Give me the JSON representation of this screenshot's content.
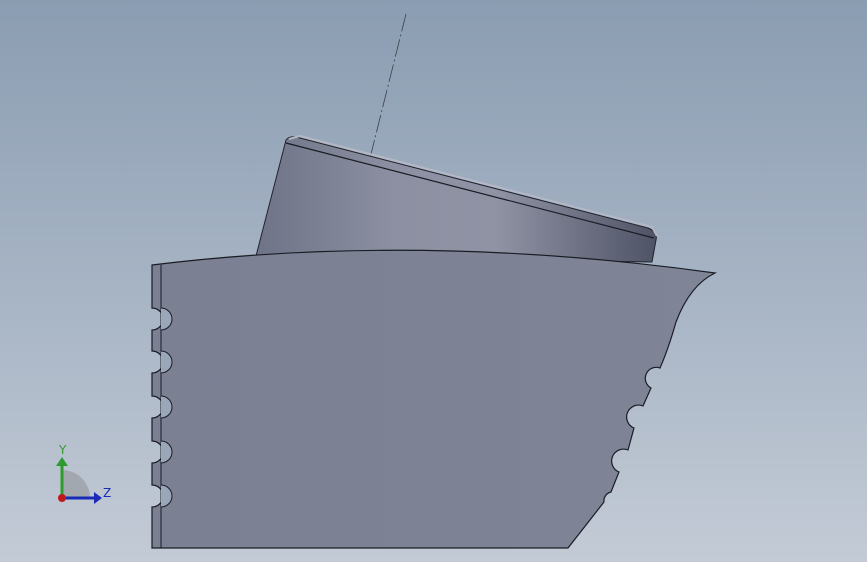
{
  "viewport": {
    "background_top": "#8b9db2",
    "background_bottom": "#c3cbd6"
  },
  "model": {
    "body_color": "#7d8294",
    "edge_color": "#1a1c24",
    "top_face_color": "#8a8ea0",
    "axis_line_style": "dash-dot"
  },
  "triad": {
    "y_label": "Y",
    "z_label": "Z",
    "y_color": "#2f9a2f",
    "z_color": "#1a2bb8",
    "x_color": "#c01818"
  }
}
